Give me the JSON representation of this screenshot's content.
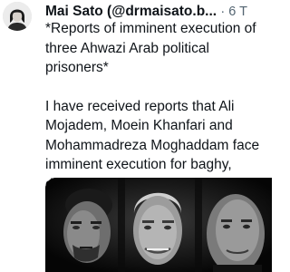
{
  "tweet": {
    "author_name": "Mai Sato (@drmaisato.b...",
    "timestamp": "6 T",
    "paragraphs": [
      "*Reports of imminent execution of three Ahwazi Arab political prisoners*",
      "I have received reports that Ali Mojadem, Moein Khanfari and Mohammadreza Moghaddam face imminent execution for baghy, despite allegations of serious fair"
    ]
  },
  "colors": {
    "text_primary": "#0f1419",
    "text_secondary": "#536471",
    "background": "#ffffff",
    "media_background": "#0a0a0a"
  },
  "media": {
    "icons": {
      "avatar": "woman-portrait",
      "photo": "three-portraits"
    }
  }
}
